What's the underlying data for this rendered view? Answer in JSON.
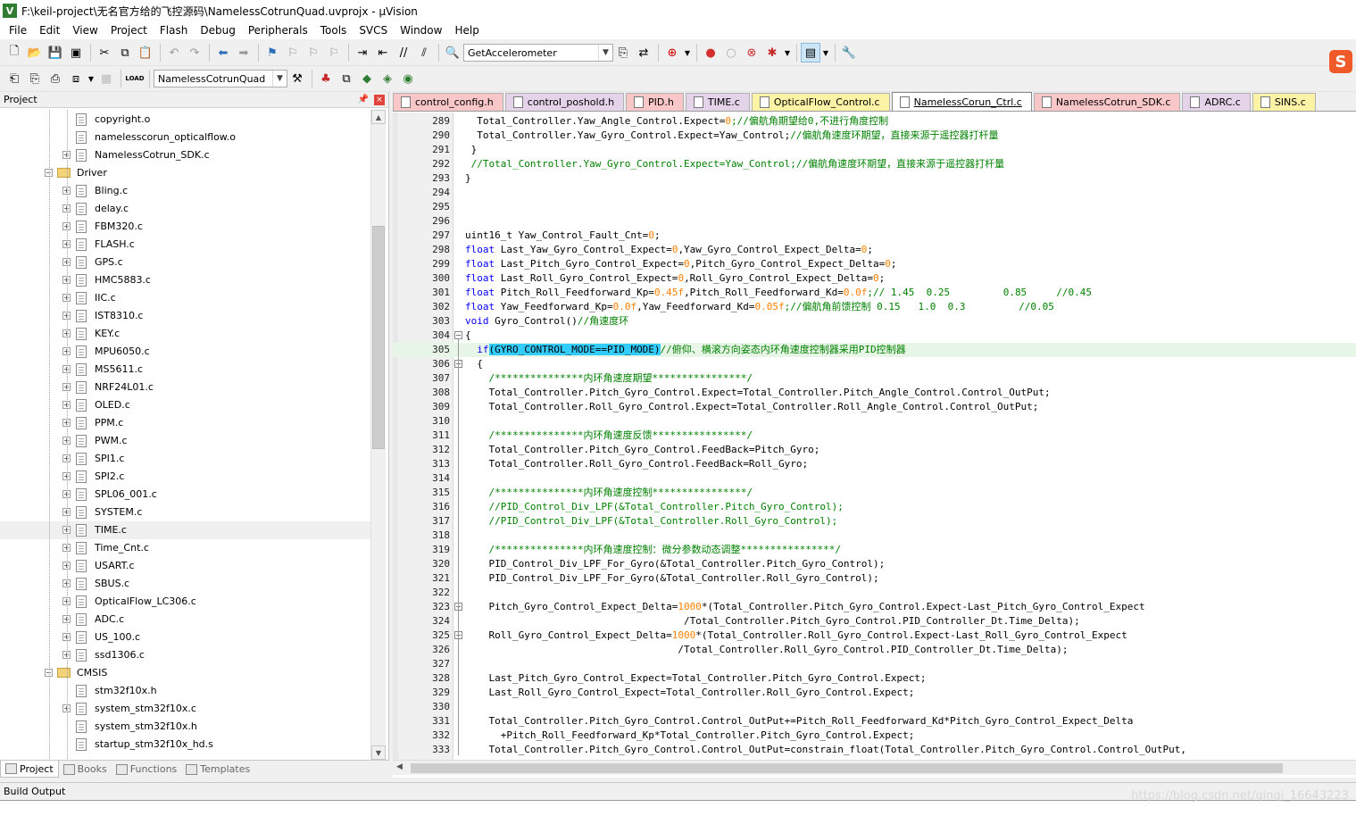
{
  "window": {
    "title": "F:\\keil-project\\无名官方给的飞控源码\\NamelessCotrunQuad.uvprojx - µVision",
    "app_icon": "keil-uvision-icon"
  },
  "menu": [
    "File",
    "Edit",
    "View",
    "Project",
    "Flash",
    "Debug",
    "Peripherals",
    "Tools",
    "SVCS",
    "Window",
    "Help"
  ],
  "toolbar": {
    "find_combo": "GetAccelerometer",
    "target_combo": "NamelessCotrunQuad",
    "load_label": "LOAD"
  },
  "project_panel": {
    "title": "Project",
    "pin_icon": "pin-icon",
    "close_label": "×",
    "items": [
      {
        "label": "copyright.o",
        "level": 2,
        "expander": false
      },
      {
        "label": "namelesscorun_opticalflow.o",
        "level": 2,
        "expander": false
      },
      {
        "label": "NamelessCotrun_SDK.c",
        "level": 2,
        "expander": true
      },
      {
        "label": "Driver",
        "level": 1,
        "folder": true,
        "expander": true
      },
      {
        "label": "Bling.c",
        "level": 2,
        "expander": true
      },
      {
        "label": "delay.c",
        "level": 2,
        "expander": true
      },
      {
        "label": "FBM320.c",
        "level": 2,
        "expander": true
      },
      {
        "label": "FLASH.c",
        "level": 2,
        "expander": true
      },
      {
        "label": "GPS.c",
        "level": 2,
        "expander": true
      },
      {
        "label": "HMC5883.c",
        "level": 2,
        "expander": true
      },
      {
        "label": "IIC.c",
        "level": 2,
        "expander": true
      },
      {
        "label": "IST8310.c",
        "level": 2,
        "expander": true
      },
      {
        "label": "KEY.c",
        "level": 2,
        "expander": true
      },
      {
        "label": "MPU6050.c",
        "level": 2,
        "expander": true
      },
      {
        "label": "MS5611.c",
        "level": 2,
        "expander": true
      },
      {
        "label": "NRF24L01.c",
        "level": 2,
        "expander": true
      },
      {
        "label": "OLED.c",
        "level": 2,
        "expander": true
      },
      {
        "label": "PPM.c",
        "level": 2,
        "expander": true
      },
      {
        "label": "PWM.c",
        "level": 2,
        "expander": true
      },
      {
        "label": "SPI1.c",
        "level": 2,
        "expander": true
      },
      {
        "label": "SPI2.c",
        "level": 2,
        "expander": true
      },
      {
        "label": "SPL06_001.c",
        "level": 2,
        "expander": true
      },
      {
        "label": "SYSTEM.c",
        "level": 2,
        "expander": true
      },
      {
        "label": "TIME.c",
        "level": 2,
        "expander": true,
        "selected": true
      },
      {
        "label": "Time_Cnt.c",
        "level": 2,
        "expander": true
      },
      {
        "label": "USART.c",
        "level": 2,
        "expander": true
      },
      {
        "label": "SBUS.c",
        "level": 2,
        "expander": true
      },
      {
        "label": "OpticalFlow_LC306.c",
        "level": 2,
        "expander": true
      },
      {
        "label": "ADC.c",
        "level": 2,
        "expander": true
      },
      {
        "label": "US_100.c",
        "level": 2,
        "expander": true
      },
      {
        "label": "ssd1306.c",
        "level": 2,
        "expander": true
      },
      {
        "label": "CMSIS",
        "level": 1,
        "folder": true,
        "expander": true
      },
      {
        "label": "stm32f10x.h",
        "level": 2,
        "expander": false
      },
      {
        "label": "system_stm32f10x.c",
        "level": 2,
        "expander": true
      },
      {
        "label": "system_stm32f10x.h",
        "level": 2,
        "expander": false
      },
      {
        "label": "startup_stm32f10x_hd.s",
        "level": 2,
        "expander": false
      }
    ],
    "tabs": [
      "Project",
      "Books",
      "Functions",
      "Templates"
    ]
  },
  "editor": {
    "tabs": [
      {
        "label": "control_config.h",
        "color": "#f9c7c8"
      },
      {
        "label": "control_poshold.h",
        "color": "#e5d3ea"
      },
      {
        "label": "PID.h",
        "color": "#f9c7c8"
      },
      {
        "label": "TIME.c",
        "color": "#e5d3ea"
      },
      {
        "label": "OpticalFlow_Control.c",
        "color": "#fdf3a7"
      },
      {
        "label": "NamelessCorun_Ctrl.c",
        "color": "#ffffff",
        "active": true
      },
      {
        "label": "NamelessCotrun_SDK.c",
        "color": "#f9c7c8"
      },
      {
        "label": "ADRC.c",
        "color": "#e5d3ea"
      },
      {
        "label": "SINS.c",
        "color": "#fdf3a7"
      }
    ],
    "lines": [
      {
        "n": "289",
        "parts": [
          {
            "t": "  Total_Controller.Yaw_Angle_Control.Expect="
          },
          {
            "t": "0",
            "c": "num"
          },
          {
            "t": ";//偏航角期望给0,不进行角度控制",
            "c": "cm"
          }
        ]
      },
      {
        "n": "290",
        "parts": [
          {
            "t": "  Total_Controller.Yaw_Gyro_Control.Expect=Yaw_Control;"
          },
          {
            "t": "//偏航角速度环期望，直接来源于遥控器打杆量",
            "c": "cm"
          }
        ]
      },
      {
        "n": "291",
        "parts": [
          {
            "t": " }"
          }
        ]
      },
      {
        "n": "292",
        "parts": [
          {
            "t": " //Total_Controller.Yaw_Gyro_Control.Expect=Yaw_Control;//偏航角速度环期望，直接来源于遥控器打杆量",
            "c": "cm"
          }
        ]
      },
      {
        "n": "293",
        "parts": [
          {
            "t": "}"
          }
        ]
      },
      {
        "n": "294",
        "parts": []
      },
      {
        "n": "295",
        "parts": []
      },
      {
        "n": "296",
        "parts": []
      },
      {
        "n": "297",
        "parts": [
          {
            "t": "uint16_t Yaw_Control_Fault_Cnt="
          },
          {
            "t": "0",
            "c": "num"
          },
          {
            "t": ";"
          }
        ]
      },
      {
        "n": "298",
        "parts": [
          {
            "t": "float",
            "c": "kw"
          },
          {
            "t": " Last_Yaw_Gyro_Control_Expect="
          },
          {
            "t": "0",
            "c": "num"
          },
          {
            "t": ",Yaw_Gyro_Control_Expect_Delta="
          },
          {
            "t": "0",
            "c": "num"
          },
          {
            "t": ";"
          }
        ]
      },
      {
        "n": "299",
        "parts": [
          {
            "t": "float",
            "c": "kw"
          },
          {
            "t": " Last_Pitch_Gyro_Control_Expect="
          },
          {
            "t": "0",
            "c": "num"
          },
          {
            "t": ",Pitch_Gyro_Control_Expect_Delta="
          },
          {
            "t": "0",
            "c": "num"
          },
          {
            "t": ";"
          }
        ]
      },
      {
        "n": "300",
        "parts": [
          {
            "t": "float",
            "c": "kw"
          },
          {
            "t": " Last_Roll_Gyro_Control_Expect="
          },
          {
            "t": "0",
            "c": "num"
          },
          {
            "t": ",Roll_Gyro_Control_Expect_Delta="
          },
          {
            "t": "0",
            "c": "num"
          },
          {
            "t": ";"
          }
        ]
      },
      {
        "n": "301",
        "parts": [
          {
            "t": "float",
            "c": "kw"
          },
          {
            "t": " Pitch_Roll_Feedforward_Kp="
          },
          {
            "t": "0.45f",
            "c": "num"
          },
          {
            "t": ",Pitch_Roll_Feedforward_Kd="
          },
          {
            "t": "0.0f",
            "c": "num"
          },
          {
            "t": ";// 1.45  0.25         0.85     //0.45",
            "c": "cm"
          }
        ]
      },
      {
        "n": "302",
        "parts": [
          {
            "t": "float",
            "c": "kw"
          },
          {
            "t": " Yaw_Feedforward_Kp="
          },
          {
            "t": "0.0f",
            "c": "num"
          },
          {
            "t": ",Yaw_Feedforward_Kd="
          },
          {
            "t": "0.05f",
            "c": "num"
          },
          {
            "t": ";//偏航角前馈控制 0.15   1.0  0.3         //0.05",
            "c": "cm"
          }
        ]
      },
      {
        "n": "303",
        "parts": [
          {
            "t": "void",
            "c": "kw"
          },
          {
            "t": " Gyro_Control()"
          },
          {
            "t": "//角速度环",
            "c": "cm"
          }
        ]
      },
      {
        "n": "304",
        "parts": [
          {
            "t": "{"
          }
        ],
        "fold": true
      },
      {
        "n": "305",
        "parts": [
          {
            "t": "  "
          },
          {
            "t": "if",
            "c": "kw"
          },
          {
            "t": "(GYRO_CONTROL_MODE==PID_MODE)",
            "c": "hl"
          },
          {
            "t": "//俯仰、横滚方向姿态内环角速度控制器采用PID控制器",
            "c": "cm"
          }
        ],
        "current": true
      },
      {
        "n": "306",
        "parts": [
          {
            "t": "  {"
          }
        ],
        "fold": true
      },
      {
        "n": "307",
        "parts": [
          {
            "t": "    /***************内环角速度期望****************/",
            "c": "cm"
          }
        ]
      },
      {
        "n": "308",
        "parts": [
          {
            "t": "    Total_Controller.Pitch_Gyro_Control.Expect=Total_Controller.Pitch_Angle_Control.Control_OutPut;"
          }
        ]
      },
      {
        "n": "309",
        "parts": [
          {
            "t": "    Total_Controller.Roll_Gyro_Control.Expect=Total_Controller.Roll_Angle_Control.Control_OutPut;"
          }
        ]
      },
      {
        "n": "310",
        "parts": []
      },
      {
        "n": "311",
        "parts": [
          {
            "t": "    /***************内环角速度反馈****************/",
            "c": "cm"
          }
        ]
      },
      {
        "n": "312",
        "parts": [
          {
            "t": "    Total_Controller.Pitch_Gyro_Control.FeedBack=Pitch_Gyro;"
          }
        ]
      },
      {
        "n": "313",
        "parts": [
          {
            "t": "    Total_Controller.Roll_Gyro_Control.FeedBack=Roll_Gyro;"
          }
        ]
      },
      {
        "n": "314",
        "parts": []
      },
      {
        "n": "315",
        "parts": [
          {
            "t": "    /***************内环角速度控制****************/",
            "c": "cm"
          }
        ]
      },
      {
        "n": "316",
        "parts": [
          {
            "t": "    //PID_Control_Div_LPF(&Total_Controller.Pitch_Gyro_Control);",
            "c": "cm"
          }
        ]
      },
      {
        "n": "317",
        "parts": [
          {
            "t": "    //PID_Control_Div_LPF(&Total_Controller.Roll_Gyro_Control);",
            "c": "cm"
          }
        ]
      },
      {
        "n": "318",
        "parts": []
      },
      {
        "n": "319",
        "parts": [
          {
            "t": "    /***************内环角速度控制：微分参数动态调整****************/",
            "c": "cm"
          }
        ]
      },
      {
        "n": "320",
        "parts": [
          {
            "t": "    PID_Control_Div_LPF_For_Gyro(&Total_Controller.Pitch_Gyro_Control);"
          }
        ]
      },
      {
        "n": "321",
        "parts": [
          {
            "t": "    PID_Control_Div_LPF_For_Gyro(&Total_Controller.Roll_Gyro_Control);"
          }
        ]
      },
      {
        "n": "322",
        "parts": []
      },
      {
        "n": "323",
        "parts": [
          {
            "t": "    Pitch_Gyro_Control_Expect_Delta="
          },
          {
            "t": "1000",
            "c": "num"
          },
          {
            "t": "*(Total_Controller.Pitch_Gyro_Control.Expect-Last_Pitch_Gyro_Control_Expect"
          }
        ],
        "fold": true
      },
      {
        "n": "324",
        "parts": [
          {
            "t": "                                     /Total_Controller.Pitch_Gyro_Control.PID_Controller_Dt.Time_Delta);"
          }
        ]
      },
      {
        "n": "325",
        "parts": [
          {
            "t": "    Roll_Gyro_Control_Expect_Delta="
          },
          {
            "t": "1000",
            "c": "num"
          },
          {
            "t": "*(Total_Controller.Roll_Gyro_Control.Expect-Last_Roll_Gyro_Control_Expect"
          }
        ],
        "fold": true
      },
      {
        "n": "326",
        "parts": [
          {
            "t": "                                    /Total_Controller.Roll_Gyro_Control.PID_Controller_Dt.Time_Delta);"
          }
        ]
      },
      {
        "n": "327",
        "parts": []
      },
      {
        "n": "328",
        "parts": [
          {
            "t": "    Last_Pitch_Gyro_Control_Expect=Total_Controller.Pitch_Gyro_Control.Expect;"
          }
        ]
      },
      {
        "n": "329",
        "parts": [
          {
            "t": "    Last_Roll_Gyro_Control_Expect=Total_Controller.Roll_Gyro_Control.Expect;"
          }
        ]
      },
      {
        "n": "330",
        "parts": []
      },
      {
        "n": "331",
        "parts": [
          {
            "t": "    Total_Controller.Pitch_Gyro_Control.Control_OutPut+=Pitch_Roll_Feedforward_Kd*Pitch_Gyro_Control_Expect_Delta"
          }
        ]
      },
      {
        "n": "332",
        "parts": [
          {
            "t": "      +Pitch_Roll_Feedforward_Kp*Total_Controller.Pitch_Gyro_Control.Expect;"
          }
        ]
      },
      {
        "n": "333",
        "parts": [
          {
            "t": "    Total_Controller.Pitch_Gyro_Control.Control_OutPut=constrain_float(Total_Controller.Pitch_Gyro_Control.Control_OutPut,"
          }
        ]
      }
    ]
  },
  "build_output": {
    "title": "Build Output",
    "watermark": "https://blog.csdn.net/qinqi_16643223"
  },
  "colors": {
    "keyword": "#0000ff",
    "number": "#ff8000",
    "comment": "#008000",
    "selection": "#33ccff",
    "current_line": "#e8f6e8"
  }
}
